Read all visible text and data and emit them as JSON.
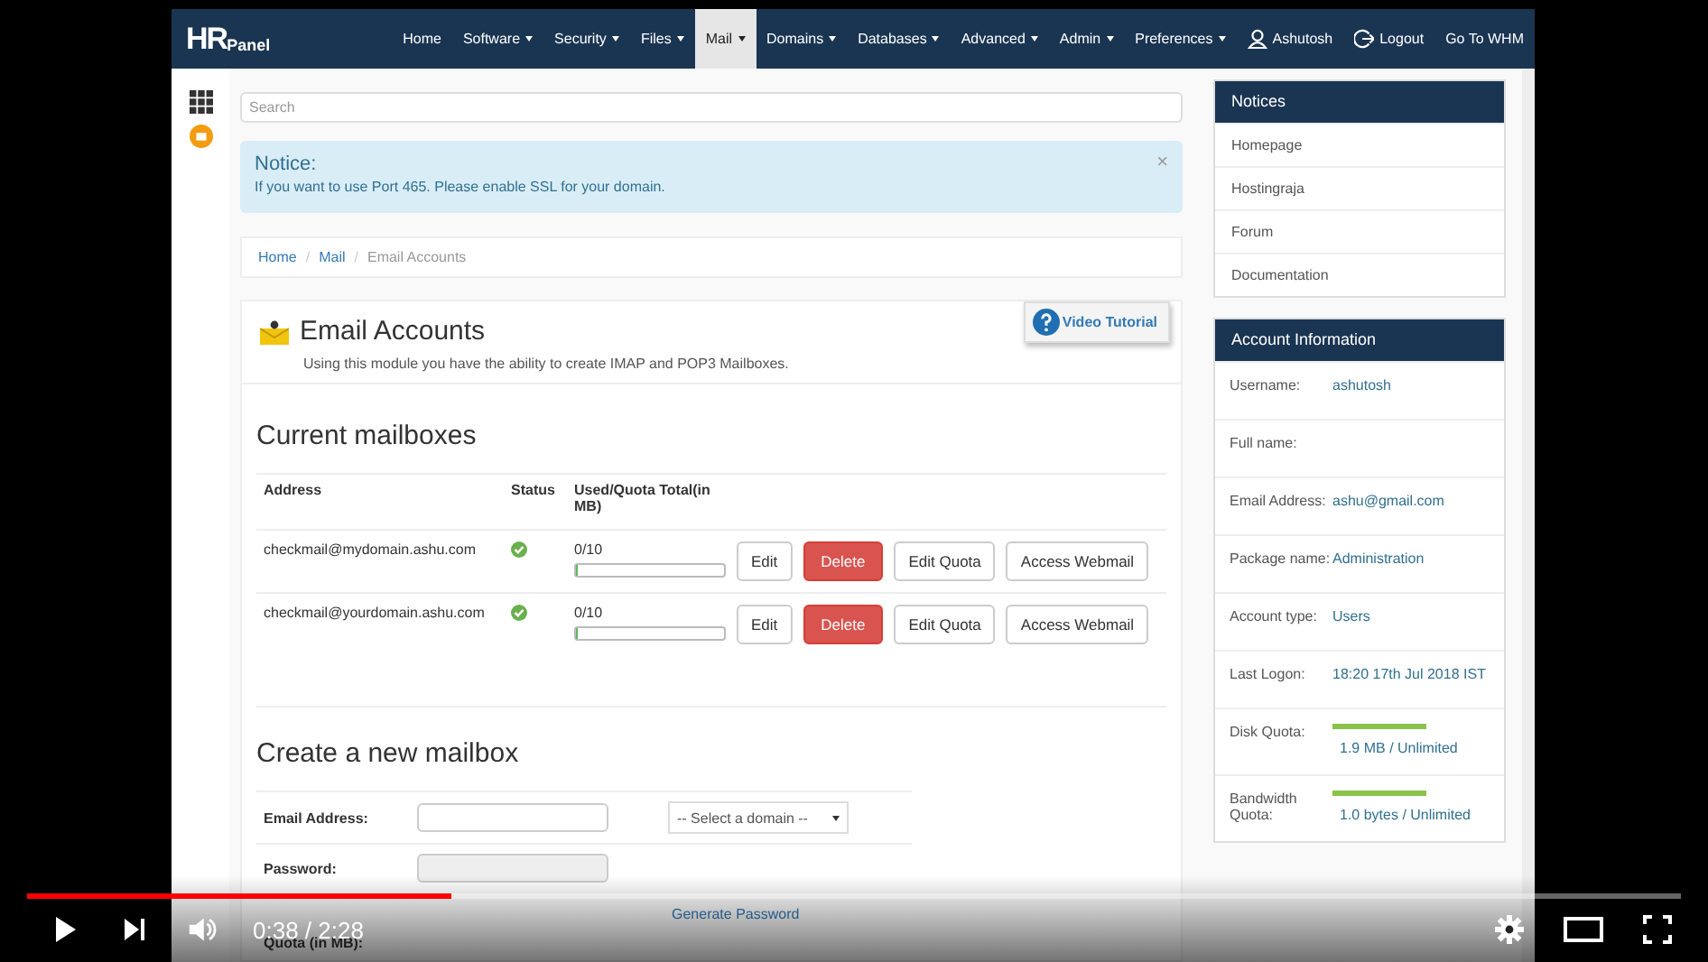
{
  "nav": {
    "logo_main": "HR",
    "logo_sub": "Panel",
    "items": [
      {
        "label": "Home",
        "dropdown": false,
        "selected": false
      },
      {
        "label": "Software",
        "dropdown": true,
        "selected": false
      },
      {
        "label": "Security",
        "dropdown": true,
        "selected": false
      },
      {
        "label": "Files",
        "dropdown": true,
        "selected": false
      },
      {
        "label": "Mail",
        "dropdown": true,
        "selected": true
      },
      {
        "label": "Domains",
        "dropdown": true,
        "selected": false
      },
      {
        "label": "Databases",
        "dropdown": true,
        "selected": false
      },
      {
        "label": "Advanced",
        "dropdown": true,
        "selected": false
      },
      {
        "label": "Admin",
        "dropdown": true,
        "selected": false
      },
      {
        "label": "Preferences",
        "dropdown": true,
        "selected": false
      }
    ],
    "user": "Ashutosh",
    "logout": "Logout",
    "whm": "Go To WHM"
  },
  "search": {
    "placeholder": "Search"
  },
  "notice": {
    "title": "Notice:",
    "text": "If you want to use Port 465. Please enable SSL for your domain.",
    "close": "×"
  },
  "breadcrumb": [
    {
      "kind": "link",
      "text": "Home"
    },
    {
      "kind": "separator",
      "text": "/"
    },
    {
      "kind": "link",
      "text": "Mail"
    },
    {
      "kind": "separator",
      "text": "/"
    },
    {
      "kind": "current",
      "text": "Email Accounts"
    }
  ],
  "module": {
    "title": "Email Accounts",
    "description": "Using this module you have the ability to create IMAP and POP3 Mailboxes.",
    "video_tutorial": "Video Tutorial"
  },
  "mailboxes": {
    "heading": "Current mailboxes",
    "columns": [
      "Address",
      "Status",
      "Used/Quota Total(in MB)"
    ],
    "rows": [
      {
        "address": "checkmail@mydomain.ashu.com",
        "active": true,
        "usage": "0/10",
        "level": 0,
        "actions": [
          {
            "label": "Edit",
            "kind": "default"
          },
          {
            "label": "Delete",
            "kind": "danger"
          },
          {
            "label": "Edit Quota",
            "kind": "default"
          },
          {
            "label": "Access Webmail",
            "kind": "default"
          }
        ]
      },
      {
        "address": "checkmail@yourdomain.ashu.com",
        "active": true,
        "usage": "0/10",
        "level": 0,
        "actions": [
          {
            "label": "Edit",
            "kind": "default"
          },
          {
            "label": "Delete",
            "kind": "danger"
          },
          {
            "label": "Edit Quota",
            "kind": "default"
          },
          {
            "label": "Access Webmail",
            "kind": "default"
          }
        ]
      }
    ]
  },
  "create": {
    "heading": "Create a new mailbox",
    "email_label": "Email Address:",
    "domain_select": "-- Select a domain --",
    "password_label": "Password:",
    "generate_password": "Generate Password",
    "quota_label": "Quota (in MB):"
  },
  "notices_panel": {
    "title": "Notices",
    "links": [
      "Homepage",
      "Hostingraja",
      "Forum",
      "Documentation"
    ]
  },
  "account": {
    "title": "Account Information",
    "rows": [
      {
        "label": "Username:",
        "value": "ashutosh",
        "kind": "text"
      },
      {
        "label": "Full name:",
        "kind": "text"
      },
      {
        "label": "Email Address:",
        "value": "ashu@gmail.com",
        "kind": "text"
      },
      {
        "label": "Package name:",
        "value": "Administration",
        "kind": "text"
      },
      {
        "label": "Account type:",
        "value": "Users",
        "kind": "text"
      },
      {
        "label": "Last Logon:",
        "value": "18:20 17th Jul 2018 IST",
        "kind": "text"
      },
      {
        "label": "Disk Quota:",
        "value": "1.9 MB / Unlimited",
        "kind": "meter",
        "level": 1
      },
      {
        "label": "Bandwidth Quota:",
        "value": "1.0 bytes / Unlimited",
        "kind": "meter",
        "level": 1
      }
    ]
  },
  "player": {
    "time": "0:38 / 2:28",
    "level": 0.257
  }
}
